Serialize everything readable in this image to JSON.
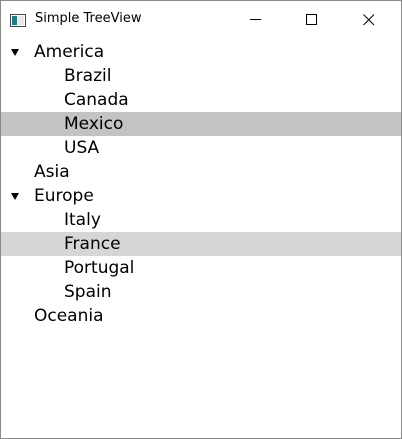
{
  "window": {
    "title": "Simple TreeView"
  },
  "tree": {
    "groups": [
      {
        "label": "America",
        "expanded": true,
        "children": [
          "Brazil",
          "Canada",
          "Mexico",
          "USA"
        ]
      },
      {
        "label": "Asia",
        "expanded": false,
        "children": []
      },
      {
        "label": "Europe",
        "expanded": true,
        "children": [
          "Italy",
          "France",
          "Portugal",
          "Spain"
        ]
      },
      {
        "label": "Oceania",
        "expanded": false,
        "children": []
      }
    ],
    "selected_item": "Mexico",
    "hovered_item": "France"
  },
  "colors": {
    "selected_bg": "#c3c3c3",
    "hover_bg": "#d6d6d6",
    "icon_teal": "#1b7f86"
  }
}
